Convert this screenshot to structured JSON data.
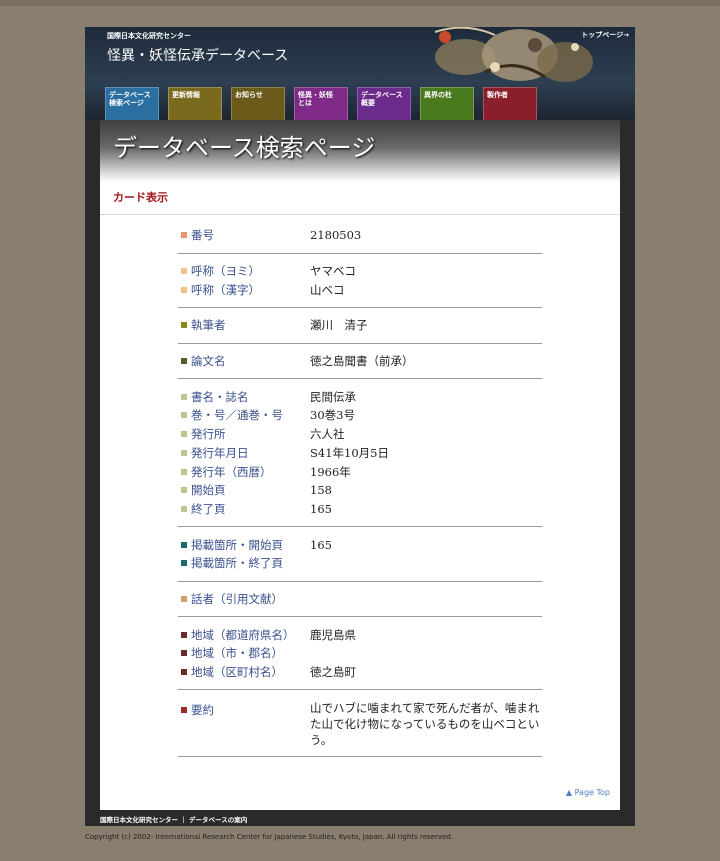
{
  "header": {
    "org": "国際日本文化研究センター",
    "site_title": "怪異・妖怪伝承データベース",
    "top_link": "トップページ→"
  },
  "nav": {
    "tabs": [
      {
        "label": "データベース\n検索ページ",
        "color": "#2a6fa0"
      },
      {
        "label": "更新情報",
        "color": "#7a6a1e"
      },
      {
        "label": "お知らせ",
        "color": "#6b5a1a"
      },
      {
        "label": "怪異・妖怪\nとは",
        "color": "#7e2a86"
      },
      {
        "label": "データベース\n概要",
        "color": "#6a2b8a"
      },
      {
        "label": "異界の杜",
        "color": "#4a7a1e"
      },
      {
        "label": "製作者",
        "color": "#8a1e2a"
      }
    ]
  },
  "page": {
    "heading": "データベース検索ページ",
    "card_label": "カード表示",
    "page_top": "▲ Page Top"
  },
  "card": {
    "groups": [
      {
        "rows": [
          {
            "label": "番号",
            "value": "2180503",
            "color": "#e8956a"
          }
        ]
      },
      {
        "rows": [
          {
            "label": "呼称（ヨミ）",
            "value": "ヤマベコ",
            "color": "#f0c08a"
          },
          {
            "label": "呼称（漢字）",
            "value": "山ベコ",
            "color": "#f0c08a"
          }
        ]
      },
      {
        "rows": [
          {
            "label": "執筆者",
            "value": "瀬川　清子",
            "color": "#8a8a1a"
          }
        ]
      },
      {
        "rows": [
          {
            "label": "論文名",
            "value": "徳之島聞書（前承）",
            "color": "#5a5a2a"
          }
        ]
      },
      {
        "rows": [
          {
            "label": "書名・誌名",
            "value": "民間伝承",
            "color": "#b8c890"
          },
          {
            "label": "巻・号／通巻・号",
            "value": "30巻3号",
            "color": "#b8c890"
          },
          {
            "label": "発行所",
            "value": "六人社",
            "color": "#b8c890"
          },
          {
            "label": "発行年月日",
            "value": "S41年10月5日",
            "color": "#b8c890"
          },
          {
            "label": "発行年（西暦）",
            "value": "1966年",
            "color": "#b8c890"
          },
          {
            "label": "開始頁",
            "value": "158",
            "color": "#b8c890"
          },
          {
            "label": "終了頁",
            "value": "165",
            "color": "#b8c890"
          }
        ]
      },
      {
        "rows": [
          {
            "label": "掲載箇所・開始頁",
            "value": "165",
            "color": "#1e6a6a"
          },
          {
            "label": "掲載箇所・終了頁",
            "value": "",
            "color": "#1e6a6a"
          }
        ]
      },
      {
        "rows": [
          {
            "label": "話者（引用文献）",
            "value": "",
            "color": "#d0a070"
          }
        ]
      },
      {
        "rows": [
          {
            "label": "地域（都道府県名）",
            "value": "鹿児島県",
            "color": "#6a2a2a"
          },
          {
            "label": "地域（市・郡名）",
            "value": "",
            "color": "#6a2a2a"
          },
          {
            "label": "地域（区町村名）",
            "value": "徳之島町",
            "color": "#6a2a2a"
          }
        ]
      },
      {
        "rows": [
          {
            "label": "要約",
            "value": "山でハブに噛まれて家で死んだ者が、噛まれた山で化け物になっているものを山ベコという。",
            "color": "#a02a2a",
            "tall": true
          }
        ]
      }
    ]
  },
  "footer": {
    "links": "国際日本文化研究センター ｜ データベースの案内",
    "copyright": "Copyright (c) 2002- International Research Center for Japanese Studies, Kyoto, Japan. All rights reserved."
  }
}
